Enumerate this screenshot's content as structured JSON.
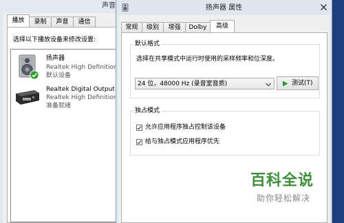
{
  "background_window": {
    "title": "声音",
    "tabs": [
      "播放",
      "录制",
      "声音",
      "通信"
    ],
    "selected_tab": "播放",
    "instruction": "选择以下播放设备来修改设置:",
    "devices": [
      {
        "name": "扬声器",
        "driver": "Realtek High Definition A",
        "status": "默认设备",
        "icon": "speaker-icon",
        "is_default": true
      },
      {
        "name": "Realtek Digital Output",
        "driver": "Realtek High Definition A",
        "status": "准备就绪",
        "icon": "digital-output-icon",
        "is_default": false
      }
    ]
  },
  "dialog": {
    "title": "扬声器 属性",
    "title_icon": "speaker-icon",
    "close_icon": "close-icon",
    "tabs": [
      "常规",
      "级别",
      "增强",
      "Dolby",
      "高级"
    ],
    "selected_tab": "高级",
    "default_format": {
      "legend": "默认格式",
      "description": "选择在共享模式中运行时使用的采样频率和位深度。",
      "selected_format": "24 位，48000 Hz (录音室音质)",
      "dropdown_icon": "chevron-down-icon",
      "test_button_icon": "play-icon",
      "test_button": "测试(T)"
    },
    "exclusive_mode": {
      "legend": "独占模式",
      "options": [
        {
          "label": "允许应用程序独占控制该设备",
          "checked": true
        },
        {
          "label": "给与独占模式应用程序优先",
          "checked": true
        }
      ]
    }
  },
  "watermark": {
    "brand": "百科全说",
    "slogan": "助你轻松解决"
  },
  "colors": {
    "desktop": "#1d3f7c",
    "window_frame": "#dfe6ee",
    "watermark_green": "#3f8f3a",
    "play_green": "#2a9b2a",
    "default_badge": "#2f9e2f"
  }
}
